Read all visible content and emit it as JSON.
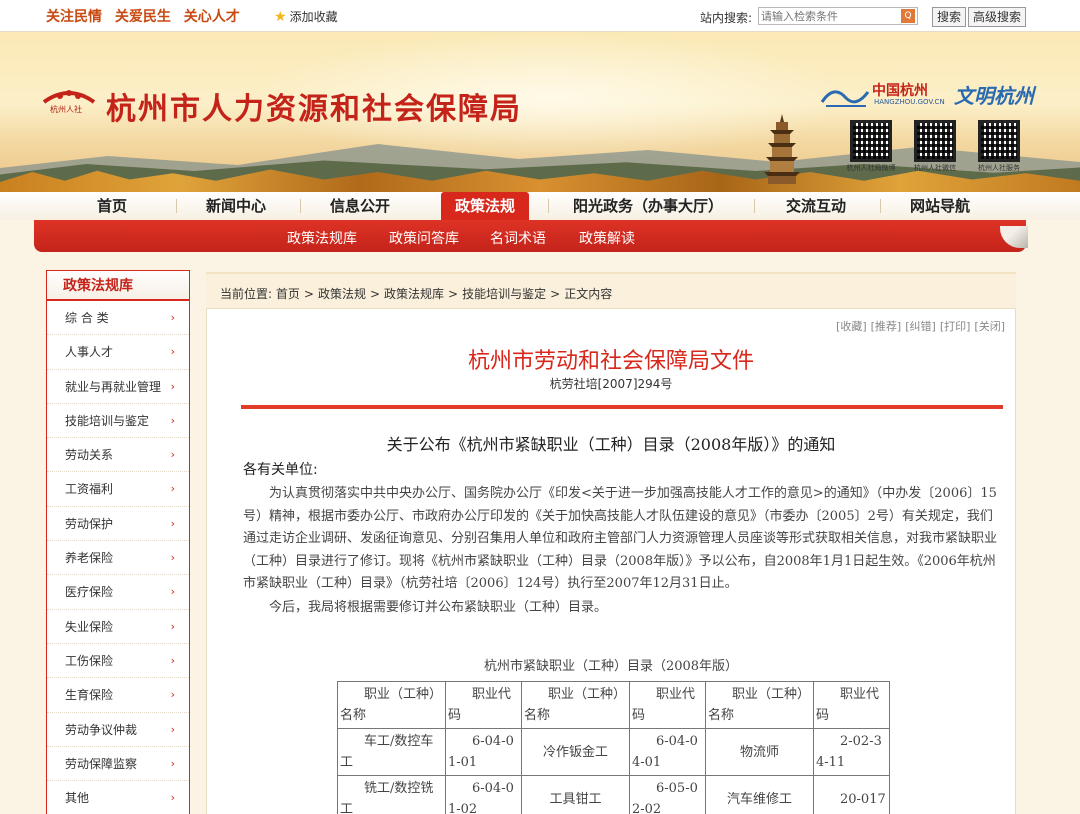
{
  "topbar": {
    "slogans": [
      "关注民情",
      "关爱民生",
      "关心人才"
    ],
    "favorite": "添加收藏",
    "search_label": "站内搜索:",
    "search_placeholder": "请输入检索条件",
    "search_button": "搜索",
    "advanced_button": "高级搜索"
  },
  "banner": {
    "logo_caption": "杭州人社",
    "site_title": "杭州市人力资源和社会保障局",
    "partner_name": "中国杭州",
    "partner_url": "HANGZHOU.GOV.CN",
    "partner2": "文明杭州",
    "qr_captions": [
      "杭州人社局微博",
      "杭州人社微信",
      "杭州人社服务"
    ]
  },
  "nav": {
    "items": [
      "首页",
      "新闻中心",
      "信息公开",
      "政策法规",
      "阳光政务（办事大厅）",
      "交流互动",
      "网站导航"
    ],
    "active": "政策法规"
  },
  "subnav": {
    "items": [
      "政策法规库",
      "政策问答库",
      "名词术语",
      "政策解读"
    ]
  },
  "sidebar": {
    "title": "政策法规库",
    "items": [
      "综 合 类",
      "人事人才",
      "就业与再就业管理",
      "技能培训与鉴定",
      "劳动关系",
      "工资福利",
      "劳动保护",
      "养老保险",
      "医疗保险",
      "失业保险",
      "工伤保险",
      "生育保险",
      "劳动争议仲裁",
      "劳动保障监察",
      "其他"
    ],
    "arrow": "›"
  },
  "breadcrumb": {
    "label": "当前位置:",
    "items": [
      "首页",
      "政策法规",
      "政策法规库",
      "技能培训与鉴定",
      "正文内容"
    ],
    "separator": ">"
  },
  "tools": [
    "[收藏]",
    "[推荐]",
    "[纠错]",
    "[打印]",
    "[关闭]"
  ],
  "document": {
    "header": "杭州市劳动和社会保障局文件",
    "number": "杭劳社培[2007]294号",
    "title": "关于公布《杭州市紧缺职业（工种）目录（2008年版）》的通知",
    "salutation": "各有关单位:",
    "paragraph1": "为认真贯彻落实中共中央办公厅、国务院办公厅《印发<关于进一步加强高技能人才工作的意见>的通知》（中办发〔2006〕15号）精神，根据市委办公厅、市政府办公厅印发的《关于加快高技能人才队伍建设的意见》（市委办〔2005〕2号）有关规定，我们通过走访企业调研、发函征询意见、分别召集用人单位和政府主管部门人力资源管理人员座谈等形式获取相关信息，对我市紧缺职业（工种）目录进行了修订。现将《杭州市紧缺职业（工种）目录（2008年版）》予以公布，自2008年1月1日起生效。《2006年杭州市紧缺职业（工种）目录》（杭劳社培〔2006〕124号）执行至2007年12月31日止。",
    "paragraph2": "今后，我局将根据需要修订并公布紧缺职业（工种）目录。",
    "table_caption": "杭州市紧缺职业（工种）目录（2008年版）",
    "table_headers": [
      "职业（工种）名称",
      "职业代码",
      "职业（工种）名称",
      "职业代码",
      "职业（工种）名称",
      "职业代码"
    ],
    "table_rows": [
      [
        "车工/数控车工",
        "6-04-01-01",
        "冷作钣金工",
        "6-04-04-01",
        "物流师",
        "2-02-34-11"
      ],
      [
        "铣工/数控铣工",
        "6-04-01-02",
        "工具钳工",
        "6-05-02-02",
        "汽车维修工",
        "20-017"
      ]
    ]
  }
}
